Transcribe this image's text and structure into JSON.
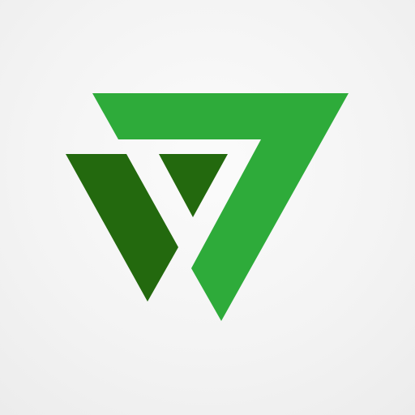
{
  "logo": {
    "icon": "stylized-v-triangle-logo-icon",
    "colors": {
      "background": "#f3f3f3",
      "light_green": "#2eab3a",
      "dark_green": "#23690e"
    }
  }
}
